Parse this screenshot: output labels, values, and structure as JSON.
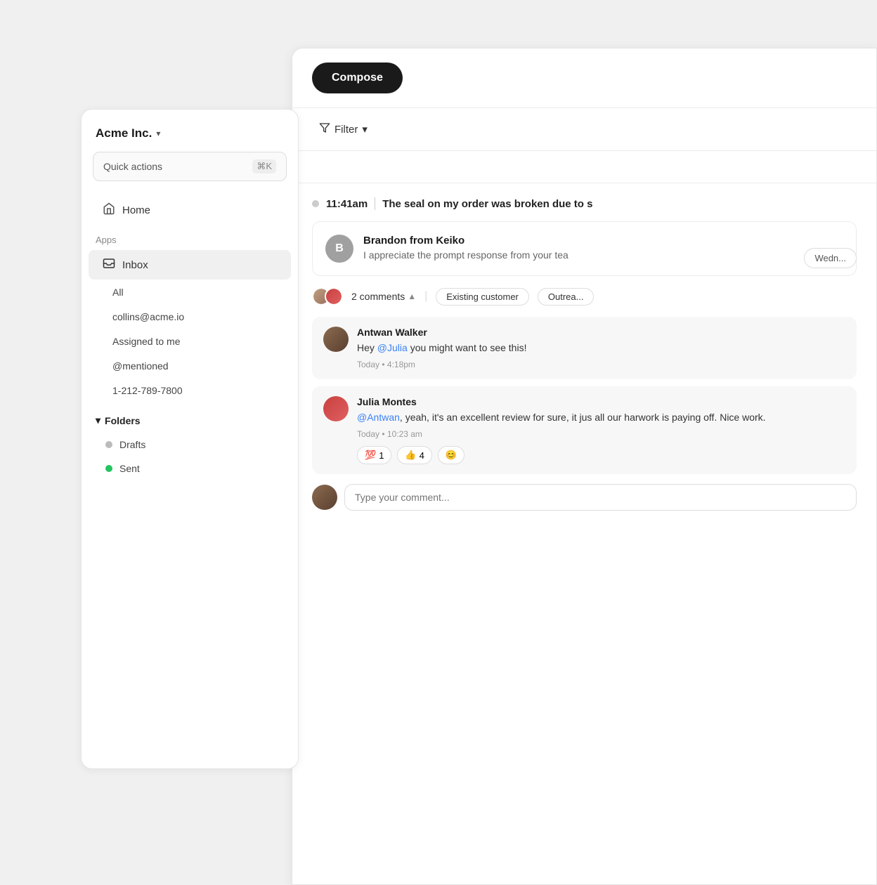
{
  "sidebar": {
    "company_name": "Acme Inc.",
    "quick_actions_placeholder": "Quick actions",
    "quick_actions_shortcut": "⌘K",
    "nav": {
      "home_label": "Home",
      "apps_section_label": "Apps",
      "inbox_label": "Inbox",
      "sub_items": [
        {
          "label": "All"
        },
        {
          "label": "collins@acme.io"
        },
        {
          "label": "Assigned to me"
        },
        {
          "label": "@mentioned"
        },
        {
          "label": "1-212-789-7800"
        }
      ],
      "folders_label": "Folders",
      "folder_items": [
        {
          "label": "Drafts",
          "dot_color": "gray"
        },
        {
          "label": "Sent",
          "dot_color": "green"
        }
      ]
    }
  },
  "main": {
    "compose_label": "Compose",
    "filter_label": "Filter",
    "date_badge": "Wedn...",
    "message_time": "11:41am",
    "message_subject": "The seal on my order was broken due to s",
    "message_card": {
      "sender_initial": "B",
      "sender_name": "Brandon from Keiko",
      "preview": "I appreciate the prompt response from your tea"
    },
    "comments": {
      "count_text": "2 comments",
      "tags": [
        "Existing customer",
        "Outrea..."
      ]
    },
    "comment_list": [
      {
        "name": "Antwan Walker",
        "text_before": "Hey ",
        "mention": "@Julia",
        "text_after": " you might want to see this!",
        "time": "Today • 4:18pm"
      },
      {
        "name": "Julia Montes",
        "mention_start": "@Antwan",
        "text_after": ", yeah,  it's an excellent review for sure, it jus all our harwork is paying off. Nice work.",
        "time": "Today • 10:23 am",
        "reactions": [
          {
            "emoji": "💯",
            "count": "1"
          },
          {
            "emoji": "👍",
            "count": "4"
          },
          {
            "emoji": "😊",
            "count": ""
          }
        ]
      }
    ],
    "comment_input_placeholder": "Type your comment..."
  }
}
